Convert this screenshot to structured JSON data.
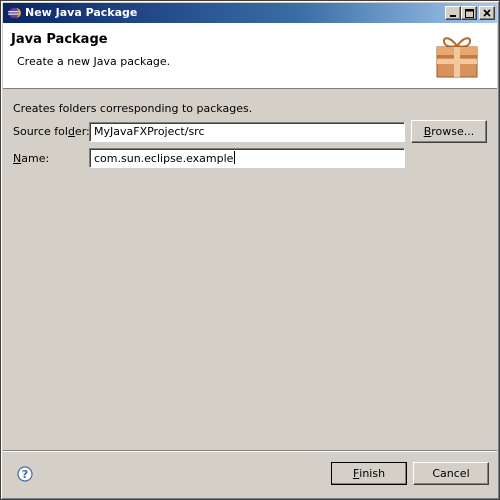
{
  "window": {
    "title": "New Java Package",
    "controls": {
      "minimize": "_",
      "maximize": "□",
      "close": "×"
    }
  },
  "banner": {
    "title": "Java Package",
    "description": "Create a new Java package.",
    "image_icon": "package-box-icon"
  },
  "form": {
    "description": "Creates folders corresponding to packages.",
    "source_folder": {
      "label_pre": "Source fol",
      "label_mnemonic": "d",
      "label_post": "er:",
      "value": "MyJavaFXProject/src"
    },
    "browse_button": {
      "label_mnemonic": "B",
      "label_post": "rowse..."
    },
    "name": {
      "label_mnemonic": "N",
      "label_post": "ame:",
      "value": "com.sun.eclipse.example"
    }
  },
  "footer": {
    "help_icon": "help-icon",
    "finish_button": {
      "label_mnemonic": "F",
      "label_post": "inish"
    },
    "cancel_button": {
      "label": "Cancel"
    }
  },
  "colors": {
    "dialog_background": "#d4d0c8",
    "titlebar_start": "#0a246a",
    "titlebar_end": "#a6caf0",
    "banner_background": "#ffffff",
    "help_icon_blue": "#3a6ea5"
  }
}
